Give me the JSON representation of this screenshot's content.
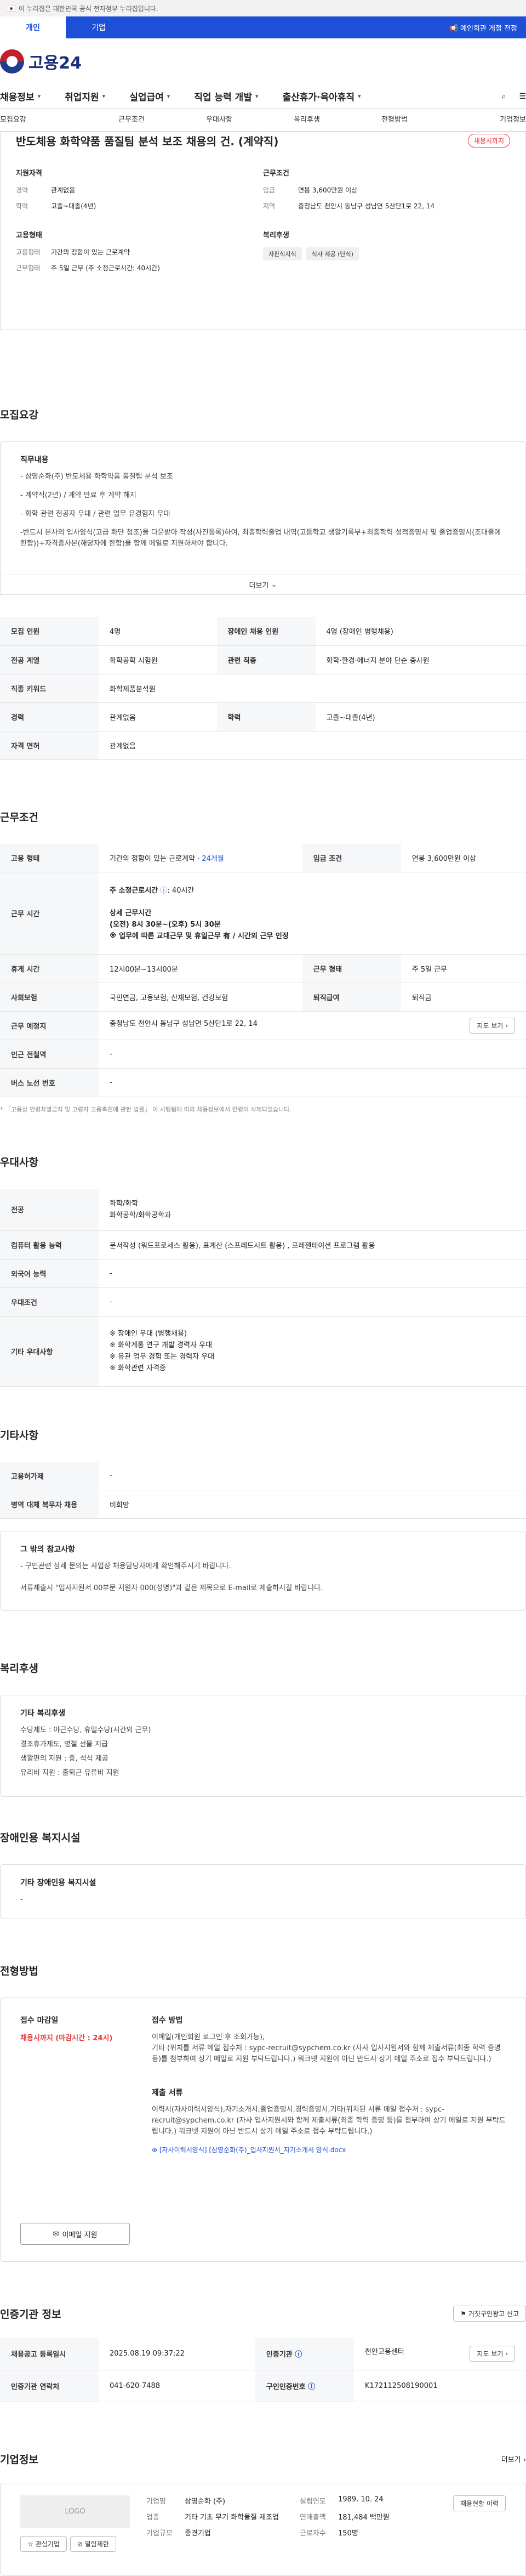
{
  "gov_bar": {
    "text": "이 누리집은 대한민국 공식 전자정부 누리집입니다."
  },
  "user_tabs": [
    {
      "label": "개인"
    },
    {
      "label": "기업"
    }
  ],
  "site_link": "📢 예인회관 게정 전정",
  "logo": {
    "text": "고용24"
  },
  "gnb": [
    {
      "label": "채용정보"
    },
    {
      "label": "취업지원"
    },
    {
      "label": "실업급여"
    },
    {
      "label": "직업 능력 개발"
    },
    {
      "label": "출산휴가·육아휴직"
    }
  ],
  "page_tabs": [
    "모집요강",
    "근무조건",
    "우대사항",
    "복리후생",
    "전형방법",
    "기업정보"
  ],
  "summary": {
    "title": "반도체용 화학약품 품질팀 분석 보조 채용의 건. (계약직)",
    "status": "채용시까지",
    "left_heading": "지원자격",
    "left_kv": [
      {
        "k": "경력",
        "v": "관계없음"
      },
      {
        "k": "학력",
        "v": "고졸~대졸(4년)"
      }
    ],
    "left_heading2": "고용형태",
    "left_kv2": [
      {
        "k": "고용형태",
        "v": "기간의 정함이 있는 근로계약"
      },
      {
        "k": "근무형태",
        "v": "주 5일 근무 (주 소정근로시간: 40시간)"
      }
    ],
    "right_heading": "근무조건",
    "right_kv": [
      {
        "k": "임금",
        "v": "연봉 3,600만원 이상"
      },
      {
        "k": "지역",
        "v": "충청남도 천안시 동남구 성남면 5산단1로 22, 14"
      }
    ],
    "right_heading2": "복리후생",
    "chips": [
      "자판식지식",
      "식사 제공 (단식)"
    ]
  },
  "recruit": {
    "title": "모집요강",
    "card_heading": "직무내용",
    "lines": [
      "- 삼영순화(주) 반도체용 화학약품 품질팀 분석 보조",
      "- 계약직(2년) / 계약 만료 후 계약 해지",
      "- 화학 관련 전공자 우대 / 관련 업무 유경험자 우대",
      "-반드시 본사의 입사양식(고급 화단 첨조)을 다운받아 작성(사진등록)하여, 최종학력졸업 내역(고등학교 생활기록부+최종학력 성적증명서 및 졸업증명서(조대졸에 한함))+자격증사본(해당자에 한함)을 함께 메일로 지원하셔야 합니다."
    ],
    "more": "더보기",
    "table": [
      [
        {
          "th": "모집 인원"
        },
        {
          "td": "4명"
        },
        {
          "th": "장애인 채용 인원"
        },
        {
          "td": "4명 (장애인 병행채용)"
        }
      ],
      [
        {
          "th": "전공 계열"
        },
        {
          "td": "화학공학 시험원"
        },
        {
          "th": "관련 직종"
        },
        {
          "td": "화학·환경·에너지 분야 단순 종사원"
        }
      ],
      [
        {
          "th": "직종 키워드"
        },
        {
          "td": "화학제품분석원"
        },
        null,
        null
      ],
      [
        {
          "th": "경력"
        },
        {
          "td": "관계없음"
        },
        {
          "th": "학력"
        },
        {
          "td": "고졸~대졸(4년)"
        }
      ],
      [
        {
          "th": "자격 면허"
        },
        {
          "td": "관계없음"
        },
        null,
        null
      ]
    ]
  },
  "conditions": {
    "title": "근무조건",
    "employ_type_label": "고용 형태",
    "employ_type": "기간의 정함이 있는 근로계약 ·",
    "employ_months": "24개월",
    "wage_label": "임금 조건",
    "wage": "연봉 3,600만원 이상",
    "hours_label": "근무 시간",
    "hours_1": "주 소정근로시간",
    "hours_1b": ": 40시간",
    "hours_2": "상세 근무시간",
    "hours_3": "(오전) 8시 30분~(오후) 5시 30분",
    "hours_4": "※ 업무에 따른 교대근무 및 휴일근무 有 / 시간외 근무 인정",
    "rest_label": "휴게 시간",
    "rest": "12시00분~13시00분",
    "days_label": "근무 형태",
    "days": "주 5일 근무",
    "ins_label": "사회보험",
    "ins": "국민연금, 고용보험, 산재보험, 건강보험",
    "sev_label": "퇴직급여",
    "sev": "퇴직금",
    "place_label": "근무 예정지",
    "place": "충청남도 천안시 동남구 성남면 5산단1로 22, 14",
    "map_btn": "지도 보기",
    "station_label": "인근 전철역",
    "station": "-",
    "bus_label": "버스 노선 번호",
    "bus": "-",
    "footnote": "* 「고용상 연령차별금지 및 고령자 고용촉진에 관한 법률」 이 시행됨에 따라 채용정보에서 연령이 삭제되었습니다."
  },
  "prefer": {
    "title": "우대사항",
    "major_label": "전공",
    "major": [
      "화학/화학",
      "화학공학/화학공학과"
    ],
    "comp_label": "컴퓨터 활용 능력",
    "comp": "문서작성 (워드프로세스 활용), 표계산 (스프레드시트 활용) , 프레젠테이션 프로그램 활용",
    "lang_label": "외국어 능력",
    "lang": "-",
    "cond_label": "우대조건",
    "cond": "-",
    "etc_label": "기타 우대사항",
    "etc": [
      "※ 장애인 우대 (병행채용)",
      "※ 화학계통 연구 개발 경력자 우대",
      "※ 유관 업무 경험 또는 경력자 우대",
      "※ 화학관련 자격증"
    ]
  },
  "etc": {
    "title": "기타사항",
    "row1_label": "고용허가제",
    "row1": "-",
    "row2_label": "병역 대체 복무자 채용",
    "row2": "비희망",
    "card_heading": "그 밖의 참고사항",
    "card_lines": [
      "- 구인관련 상세 문의는 사업장 채용담당자에게 확인해주시기 바랍니다.",
      "서류제출시 \"입사지원서 00부문 지원자 000(성명)\"과 같은 제목으로 E-mail로 제출하시길 바랍니다."
    ]
  },
  "welfare": {
    "title": "복리후생",
    "card_heading": "기타 복리후생",
    "lines": [
      "수당제도 : 야근수당, 휴일수당(시간외 근무)",
      "경조휴가제도, 명절 선물 지급",
      "생활편의 지원 : 중, 석식 제공",
      "유리비 지원 : 출퇴근 유류비 지원"
    ]
  },
  "disab": {
    "title": "장애인용 복지시설",
    "card_heading": "기타 장애인용 복지시설",
    "line": "-"
  },
  "process": {
    "title": "전형방법",
    "deadline_label": "접수 마감일",
    "deadline": "채용시까지 (마감시간 : 24시)",
    "method_label": "접수 방법",
    "method": [
      "이메일(개인회원 로그인 후 조회가능),",
      "기타 (위치를 서류 메일 접수처 : sypc-recruit@sypchem.co.kr   (자사 입사지원서와 함께 제출서류(최종 학력 증명 등)를 첨부하여 상기 메일로 지원 부탁드립니다.) 워크넷 지원이 아닌 반드시 상기 메일 주소로 접수 부탁드립니다.)"
    ],
    "docs_label": "제출 서류",
    "docs": [
      "이력서(자사이력서양식),자기소개서,졸업증명서,경력증명서,기타(위치된 서류 메일 접수처 : sypc-recruit@sypchem.co.kr  (자사 입사지원서와 함께 제출서류(최종 학력 증명 등)를 첨부하여 상기 메일로 지원 부탁드립니다.) 워크넷 지원이 아닌 반드시 상기 메일 주소로 접수 부탁드립니다.)"
    ],
    "download": "[자사이력서양식] [삼영순화(주)_입사지원서_자기소개서 양식.docx",
    "apply_btn": "이메일 지원"
  },
  "certify": {
    "title": "인증기관 정보",
    "report_btn": "거짓구인광고 신고",
    "reg_label": "채용공고 등록일시",
    "reg": "2025.08.19 09:37:22",
    "agency_label": "인증기관",
    "agency": "천안고용센터",
    "contact_label": "인증기관 연락처",
    "contact": "041-620-7488",
    "job_no_label": "구인인증번호",
    "job_no": "K172112508190001",
    "map_btn": "지도 보기"
  },
  "company": {
    "title": "기업정보",
    "more": "더보기",
    "logo": "LOGO",
    "fav_btn": "관심기업",
    "block_btn": "열람제한",
    "kv": [
      {
        "k": "기업명",
        "v": "삼영순화 (주)"
      },
      {
        "k": "설립연도",
        "v": "1989. 10. 24"
      },
      {
        "k": "업종",
        "v": "기타 기초 무기 화학물질 제조업"
      },
      {
        "k": "연매출액",
        "v": "181,484 백만원"
      },
      {
        "k": "기업규모",
        "v": "중견기업"
      },
      {
        "k": "근로자수",
        "v": "150명"
      }
    ],
    "view_btn": "채용현황 이력"
  }
}
